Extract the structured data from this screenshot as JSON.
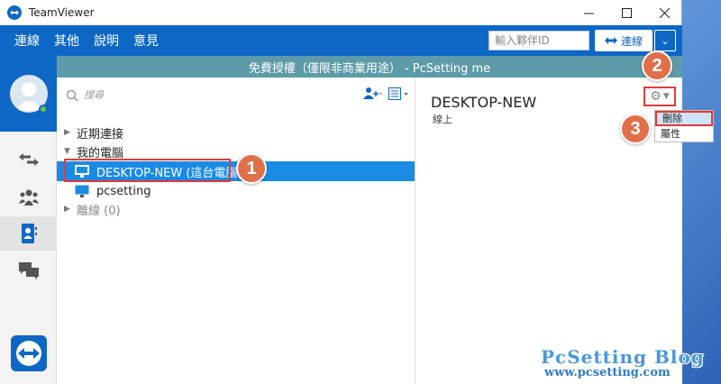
{
  "window": {
    "title": "TeamViewer"
  },
  "menu": {
    "items": [
      "連線",
      "其他",
      "說明",
      "意見"
    ]
  },
  "partner_id": {
    "placeholder": "輸入夥伴ID"
  },
  "connect_label": "連線",
  "banner": "免費授權（僅限非商業用途） - PcSetting me",
  "search": {
    "placeholder": "搜尋"
  },
  "tree": {
    "recent": "近期連接",
    "my_computers": "我的電腦",
    "device_selected": "DESKTOP-NEW (這台電腦)",
    "device_other": "pcsetting",
    "offline": "離線 (0)"
  },
  "detail": {
    "title": "DESKTOP-NEW",
    "status": "線上"
  },
  "context_menu": {
    "delete": "刪除",
    "properties": "屬性"
  },
  "callouts": [
    "1",
    "2",
    "3"
  ],
  "watermark": {
    "name": "PcSetting Blog",
    "url": "www.pcsetting.com"
  },
  "colors": {
    "accent": "#0e67c5",
    "selection": "#1a8be5",
    "banner": "#5e9ba8",
    "highlight": "#e53935",
    "callout": "#e0704a"
  }
}
